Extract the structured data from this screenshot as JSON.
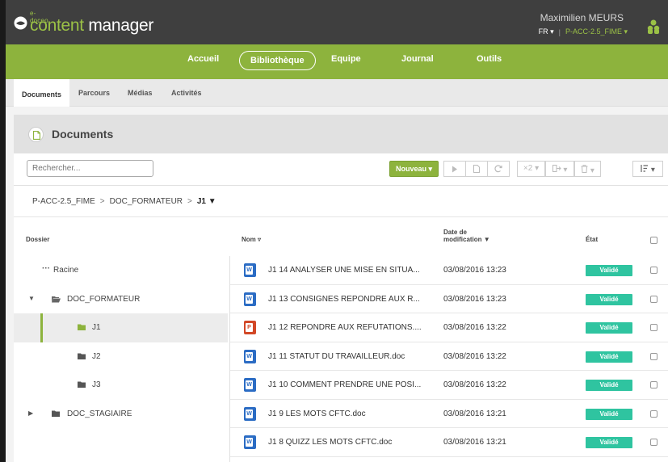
{
  "header": {
    "logo_small": "e-doceo",
    "logo_content": "content",
    "logo_manager": " manager",
    "user_name": "Maximilien MEURS",
    "language": "FR ▾",
    "separator": "|",
    "project": "P-ACC-2.5_FIME ▾"
  },
  "nav": {
    "items": [
      "Accueil",
      "Bibliothèque",
      "Equipe",
      "Journal",
      "Outils"
    ],
    "active": "Bibliothèque"
  },
  "subtabs": [
    "Documents",
    "Parcours",
    "Médias",
    "Activités"
  ],
  "page": {
    "title": "Documents",
    "search_placeholder": "Rechercher...",
    "new_button": "Nouveau ▾",
    "version_button": "×2 ▾",
    "export_button": "▾",
    "delete_button": "▾",
    "sort_button": "▾"
  },
  "breadcrumb": {
    "p1": "P-ACC-2.5_FIME",
    "sep": ">",
    "p2": "DOC_FORMATEUR",
    "current": "J1 ▼"
  },
  "columns": {
    "dossier": "Dossier",
    "nom": "Nom ▿",
    "date_line1": "Date de",
    "date_line2": "modification ▼",
    "etat": "État"
  },
  "folders": [
    {
      "label": "Racine",
      "icon": "dots-icon"
    },
    {
      "label": "DOC_FORMATEUR",
      "icon": "folder-open-icon",
      "caret": "▼"
    },
    {
      "label": "J1",
      "icon": "folder-icon"
    },
    {
      "label": "J2",
      "icon": "folder-icon"
    },
    {
      "label": "J3",
      "icon": "folder-icon"
    },
    {
      "label": "DOC_STAGIAIRE",
      "icon": "folder-icon",
      "caret": "▶"
    }
  ],
  "documents": [
    {
      "type": "word",
      "type_letter": "W",
      "name": "J1 14 ANALYSER UNE MISE EN SITUA...",
      "date": "03/08/2016 13:23",
      "status": "Validé"
    },
    {
      "type": "word",
      "type_letter": "W",
      "name": "J1 13 CONSIGNES REPONDRE AUX R...",
      "date": "03/08/2016 13:23",
      "status": "Validé"
    },
    {
      "type": "powerpoint",
      "type_letter": "P",
      "name": "J1 12 REPONDRE AUX REFUTATIONS....",
      "date": "03/08/2016 13:22",
      "status": "Validé"
    },
    {
      "type": "word",
      "type_letter": "W",
      "name": "J1 11 STATUT DU TRAVAILLEUR.doc",
      "date": "03/08/2016 13:22",
      "status": "Validé"
    },
    {
      "type": "word",
      "type_letter": "W",
      "name": "J1 10 COMMENT PRENDRE UNE POSI...",
      "date": "03/08/2016 13:22",
      "status": "Validé"
    },
    {
      "type": "word",
      "type_letter": "W",
      "name": "J1 9 LES MOTS CFTC.doc",
      "date": "03/08/2016 13:21",
      "status": "Validé"
    },
    {
      "type": "word",
      "type_letter": "W",
      "name": "J1 8 QUIZZ LES MOTS CFTC.doc",
      "date": "03/08/2016 13:21",
      "status": "Validé"
    }
  ],
  "colors": {
    "green": "#8db33d",
    "status": "#2fc4a0",
    "word": "#2b6cc4",
    "powerpoint": "#d24726"
  }
}
